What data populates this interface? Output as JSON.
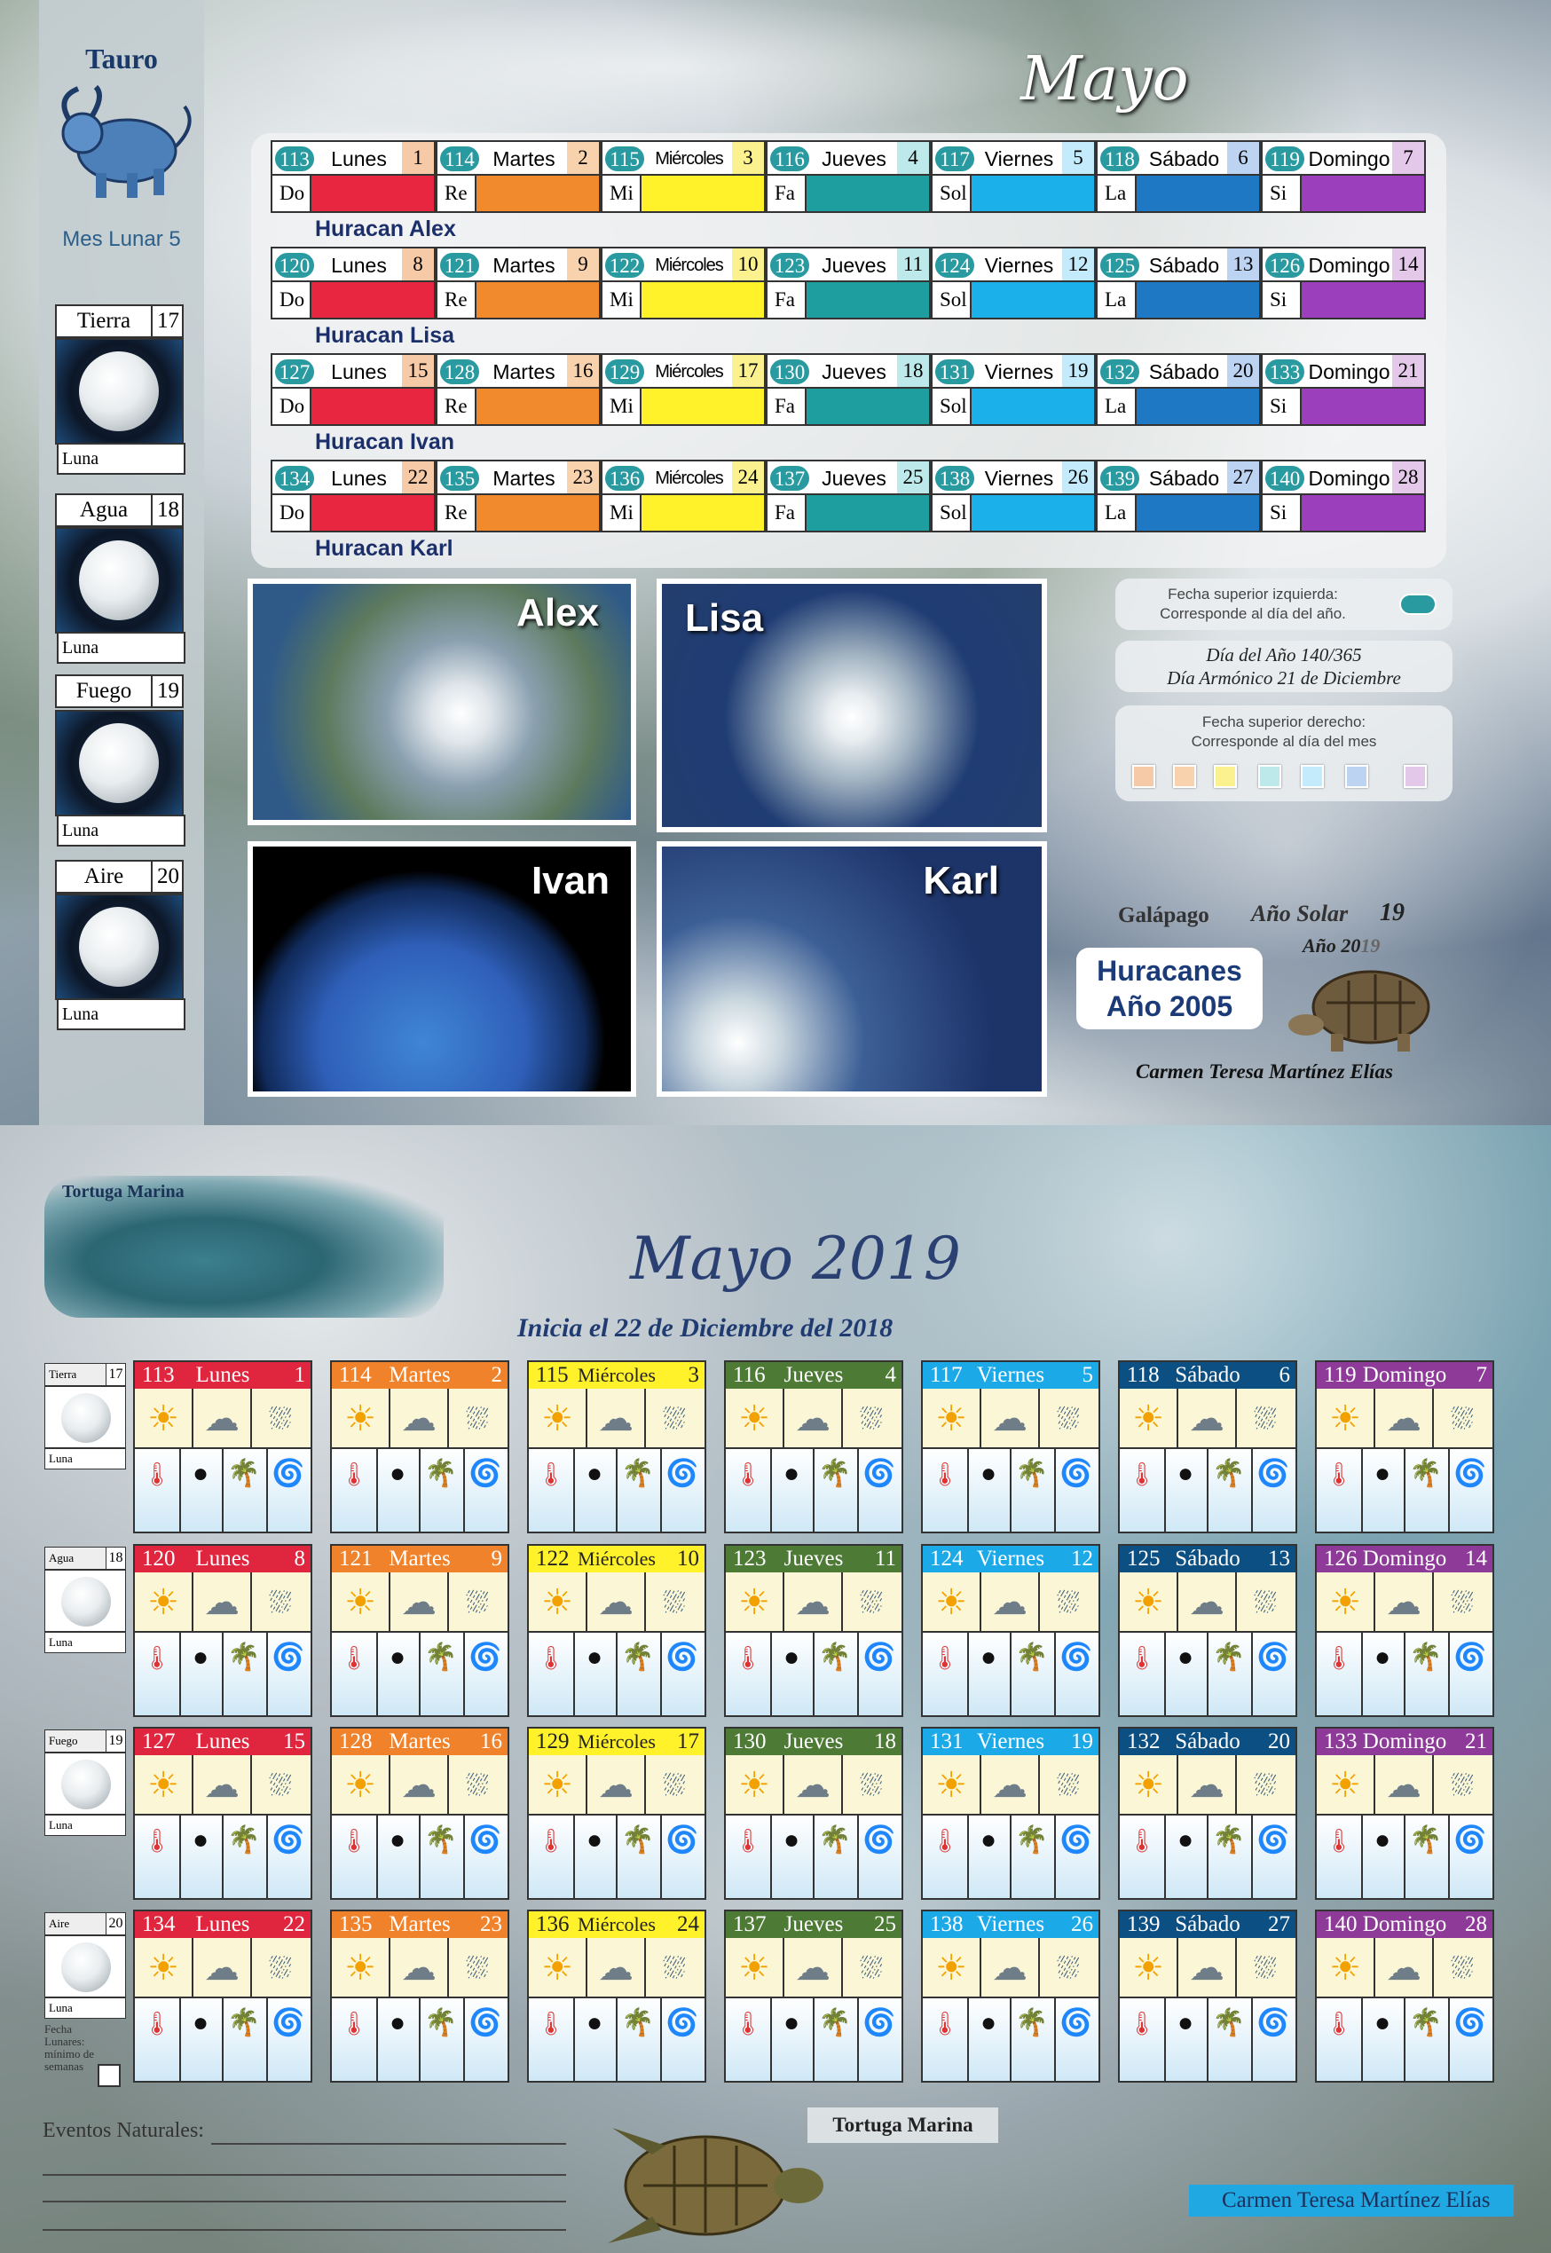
{
  "top": {
    "zodiac": "Tauro",
    "lunar_month": "Mes Lunar 5",
    "month_title": "Mayo",
    "elements": [
      {
        "name": "Tierra",
        "value": "17",
        "luna": "Luna"
      },
      {
        "name": "Agua",
        "value": "18",
        "luna": "Luna"
      },
      {
        "name": "Fuego",
        "value": "19",
        "luna": "Luna"
      },
      {
        "name": "Aire",
        "value": "20",
        "luna": "Luna"
      }
    ],
    "notes": [
      "Do",
      "Re",
      "Mi",
      "Fa",
      "Sol",
      "La",
      "Si"
    ],
    "weeks": [
      {
        "hurricane": "Huracan Alex",
        "days": [
          {
            "doy": "113",
            "name": "Lunes",
            "day": "1"
          },
          {
            "doy": "114",
            "name": "Martes",
            "day": "2"
          },
          {
            "doy": "115",
            "name": "Miércoles",
            "day": "3"
          },
          {
            "doy": "116",
            "name": "Jueves",
            "day": "4"
          },
          {
            "doy": "117",
            "name": "Viernes",
            "day": "5"
          },
          {
            "doy": "118",
            "name": "Sábado",
            "day": "6"
          },
          {
            "doy": "119",
            "name": "Domingo",
            "day": "7"
          }
        ]
      },
      {
        "hurricane": "Huracan Lisa",
        "days": [
          {
            "doy": "120",
            "name": "Lunes",
            "day": "8"
          },
          {
            "doy": "121",
            "name": "Martes",
            "day": "9"
          },
          {
            "doy": "122",
            "name": "Miércoles",
            "day": "10"
          },
          {
            "doy": "123",
            "name": "Jueves",
            "day": "11"
          },
          {
            "doy": "124",
            "name": "Viernes",
            "day": "12"
          },
          {
            "doy": "125",
            "name": "Sábado",
            "day": "13"
          },
          {
            "doy": "126",
            "name": "Domingo",
            "day": "14"
          }
        ]
      },
      {
        "hurricane": "Huracan Ivan",
        "days": [
          {
            "doy": "127",
            "name": "Lunes",
            "day": "15"
          },
          {
            "doy": "128",
            "name": "Martes",
            "day": "16"
          },
          {
            "doy": "129",
            "name": "Miércoles",
            "day": "17"
          },
          {
            "doy": "130",
            "name": "Jueves",
            "day": "18"
          },
          {
            "doy": "131",
            "name": "Viernes",
            "day": "19"
          },
          {
            "doy": "132",
            "name": "Sábado",
            "day": "20"
          },
          {
            "doy": "133",
            "name": "Domingo",
            "day": "21"
          }
        ]
      },
      {
        "hurricane": "Huracan Karl",
        "days": [
          {
            "doy": "134",
            "name": "Lunes",
            "day": "22"
          },
          {
            "doy": "135",
            "name": "Martes",
            "day": "23"
          },
          {
            "doy": "136",
            "name": "Miércoles",
            "day": "24"
          },
          {
            "doy": "137",
            "name": "Jueves",
            "day": "25"
          },
          {
            "doy": "138",
            "name": "Viernes",
            "day": "26"
          },
          {
            "doy": "139",
            "name": "Sábado",
            "day": "27"
          },
          {
            "doy": "140",
            "name": "Domingo",
            "day": "28"
          }
        ]
      }
    ],
    "photos": [
      "Alex",
      "Lisa",
      "Ivan",
      "Karl"
    ],
    "info1": [
      "Fecha superior izquierda:",
      "Corresponde al día del año."
    ],
    "info2": [
      "Día del Año 140/365",
      "Día Armónico 21 de Diciembre"
    ],
    "info3": [
      "Fecha superior derecho:",
      "Corresponde al día del mes"
    ],
    "galapago": "Galápago",
    "anio_solar_label": "Año Solar",
    "anio_solar": "19",
    "anio_label": "Año 20",
    "anio_suffix": "19",
    "huracanes": [
      "Huracanes",
      "Año 2005"
    ],
    "author": "Carmen Teresa Martínez Elías"
  },
  "bottom": {
    "turtle_top": "Tortuga Marina",
    "title": "Mayo 2019",
    "subtitle": "Inicia el 22 de Diciembre del 2018",
    "fecha_lunares": [
      "Fecha",
      "Lunares:",
      "mínimo de",
      "semanas"
    ],
    "eventos": "Eventos Naturales:",
    "turtle_bottom": "Tortuga Marina",
    "author": "Carmen Teresa Martínez Elías"
  },
  "day_colors": [
    "#e8263f",
    "#f08a2c",
    "#fff12a",
    "#1f9ea0",
    "#1cb0ea",
    "#1e78c4",
    "#9b3fbd"
  ],
  "bottom_header_colors": [
    "#e0253e",
    "#f0822b",
    "#fff22a",
    "#4d7a35",
    "#1ca9e8",
    "#0c4f83",
    "#8e3a99"
  ],
  "light_colors": [
    "#f6c9a7",
    "#f7d2ad",
    "#fbf28f",
    "#bde9ea",
    "#c3ebfb",
    "#bcd3f2",
    "#e3c8ea"
  ]
}
